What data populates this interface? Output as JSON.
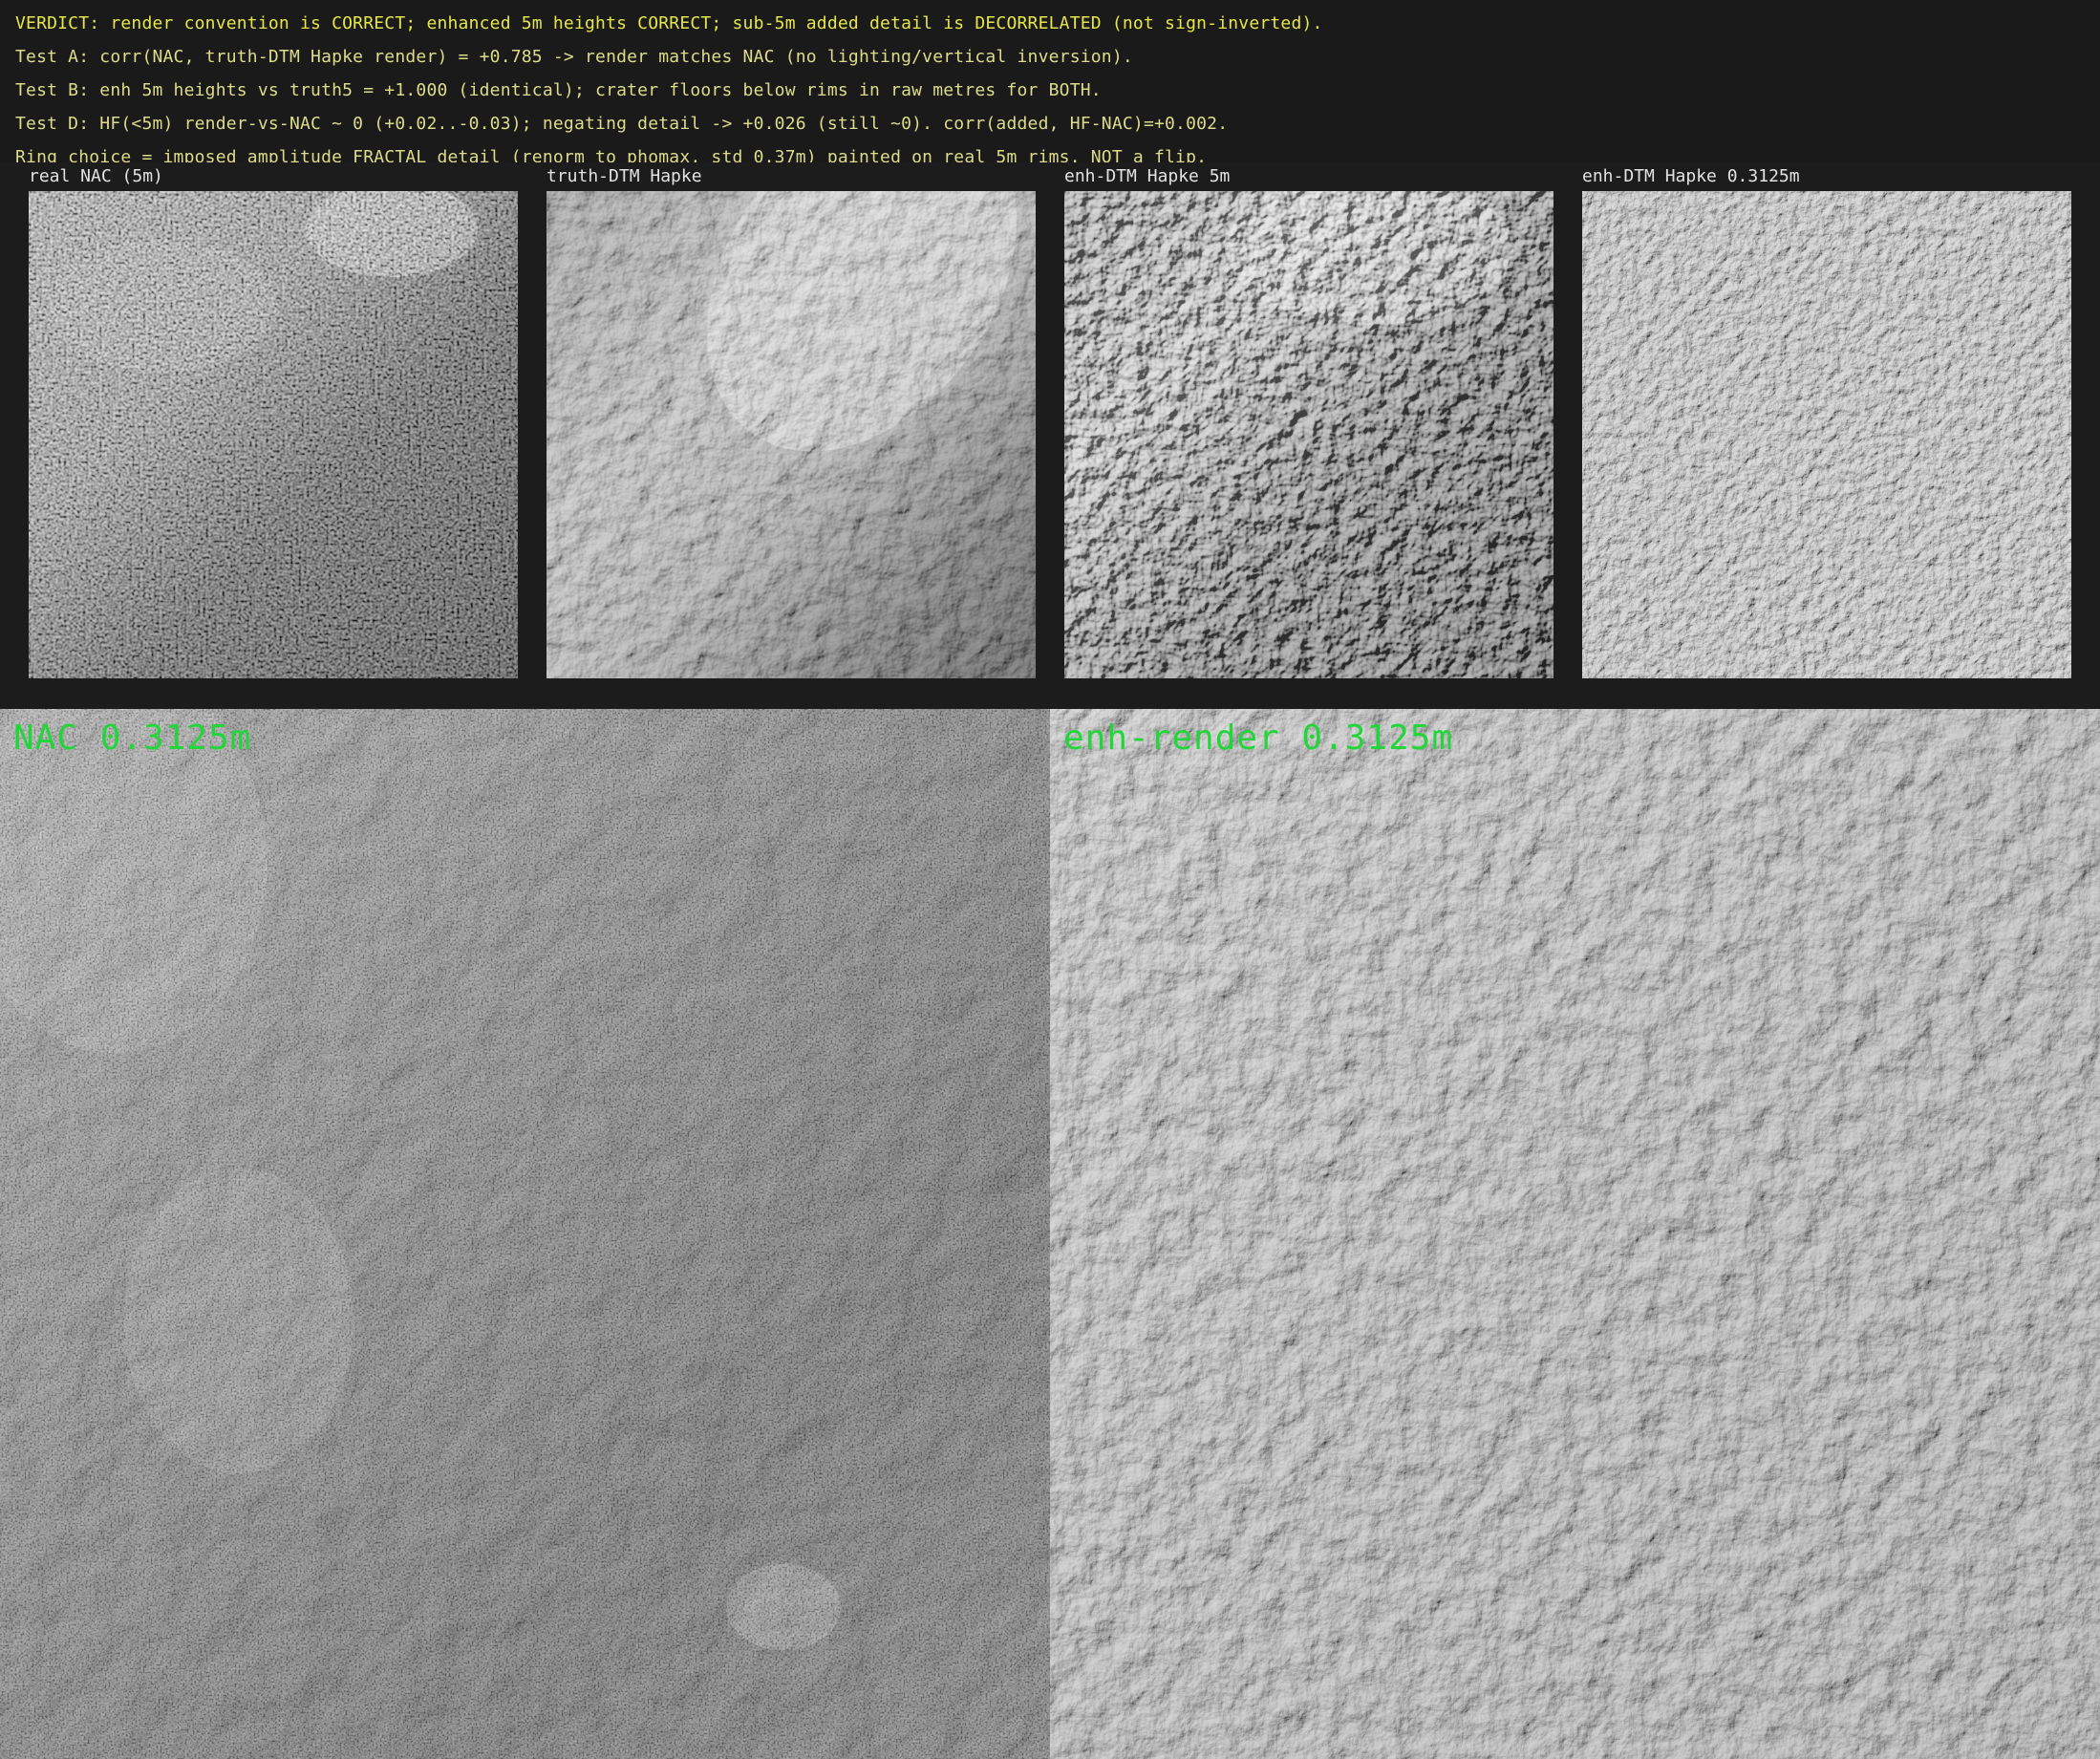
{
  "header": {
    "lines": [
      "VERDICT: render convention is CORRECT; enhanced 5m heights CORRECT; sub-5m added detail is DECORRELATED (not sign-inverted).",
      "Test A: corr(NAC, truth-DTM Hapke render) = +0.785  ->  render matches NAC (no lighting/vertical inversion).",
      "Test B: enh 5m heights vs truth5 = +1.000 (identical); crater floors below rims in raw metres for BOTH.",
      "Test D: HF(<5m) render-vs-NAC ~ 0 (+0.02..-0.03); negating detail -> +0.026 (still ~0). corr(added, HF-NAC)=+0.002.",
      "Ring_choice = imposed amplitude FRACTAL detail (renorm to phomax, std 0.37m) painted on real 5m rims. NOT a flip."
    ]
  },
  "panels": [
    {
      "title": "real NAC (5m)"
    },
    {
      "title": "truth-DTM Hapke"
    },
    {
      "title": "enh-DTM Hapke 5m"
    },
    {
      "title": "enh-DTM Hapke 0.3125m"
    }
  ],
  "bottom": {
    "left_label": "NAC 0.3125m",
    "right_label": "enh-render 0.3125m"
  },
  "colors": {
    "verdict": "#e6e64a",
    "test_lines": "#dcdc8a",
    "panel_titles": "#e2e2e2",
    "overlay_label": "#22d63a",
    "background": "#1a1a1a"
  }
}
